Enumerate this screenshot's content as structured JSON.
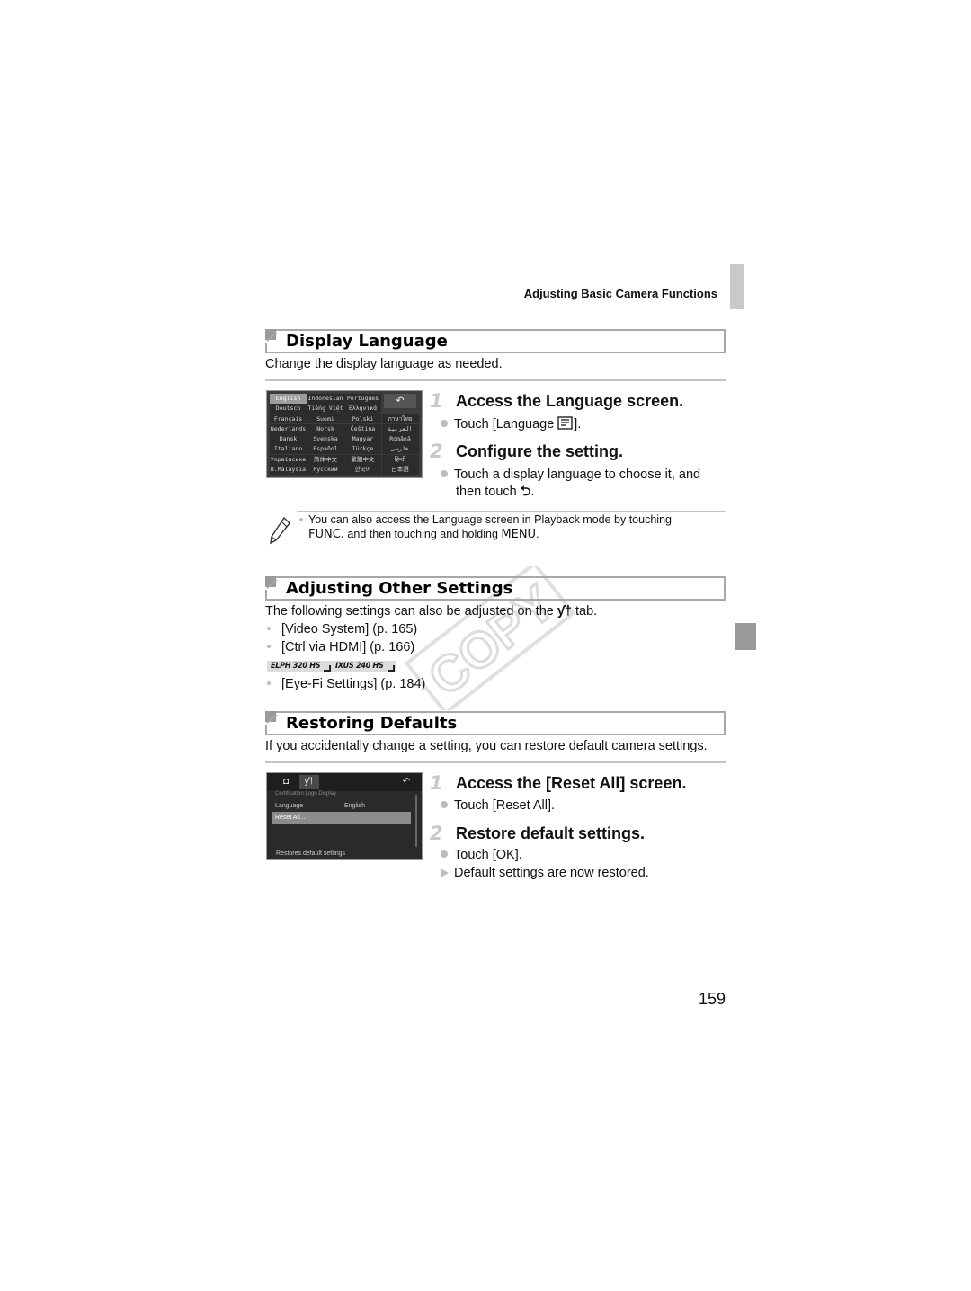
{
  "running_head": "Adjusting Basic Camera Functions",
  "page_number": "159",
  "watermark": "COPY",
  "sections": {
    "display_language": {
      "title": "Display Language",
      "intro": "Change the display language as needed.",
      "screen": {
        "back_label": "↶",
        "languages": [
          [
            "English",
            "Indonesian",
            "Português",
            ""
          ],
          [
            "Deutsch",
            "Tiếng Việt",
            "Ελληνικά",
            ""
          ],
          [
            "Français",
            "Suomi",
            "Polski",
            "ภาษาไทย"
          ],
          [
            "Nederlands",
            "Norsk",
            "Čeština",
            "العربية"
          ],
          [
            "Dansk",
            "Svenska",
            "Magyar",
            "Română"
          ],
          [
            "Italiano",
            "Español",
            "Türkçe",
            "فارسی"
          ],
          [
            "Українська",
            "简体中文",
            "繁體中文",
            "हिन्दी"
          ],
          [
            "B.Malaysia",
            "Русский",
            "한국어",
            "日本語"
          ]
        ],
        "selected": "English"
      },
      "steps": [
        {
          "num": "1",
          "title": "Access the Language screen.",
          "bullets": [
            {
              "type": "dot",
              "text": "Touch [Language ",
              "suffix": "]."
            }
          ]
        },
        {
          "num": "2",
          "title": "Configure the setting.",
          "bullets": [
            {
              "type": "dot",
              "text": "Touch a display language to choose it, and",
              "line2": "then touch ",
              "suffix": "."
            }
          ]
        }
      ],
      "note": {
        "line1": "You can also access the Language screen in Playback mode by touching",
        "kw1": "FUNC.",
        "mid": " and then touching and holding ",
        "kw2": "MENU",
        "end": "."
      }
    },
    "other_settings": {
      "title": "Adjusting Other Settings",
      "intro_pre": "The following settings can also be adjusted on the ",
      "intro_post": " tab.",
      "items": [
        "[Video System] (p. 165)",
        "[Ctrl via HDMI] (p. 166)"
      ],
      "model_tags": [
        "ELPH 320 HS",
        "IXUS 240 HS"
      ],
      "model_items": [
        "[Eye-Fi Settings] (p. 184)"
      ]
    },
    "restoring_defaults": {
      "title": "Restoring Defaults",
      "intro": "If you accidentally change a setting, you can restore default camera settings.",
      "screen": {
        "top_row": "Certification Logo Display",
        "rows": [
          {
            "label": "Language",
            "value": "English"
          },
          {
            "label": "Reset All...",
            "value": ""
          }
        ],
        "footer": "Restores default settings"
      },
      "steps": [
        {
          "num": "1",
          "title": "Access the [Reset All] screen.",
          "bullets": [
            {
              "type": "dot",
              "text": "Touch [Reset All]."
            }
          ]
        },
        {
          "num": "2",
          "title": "Restore default settings.",
          "bullets": [
            {
              "type": "dot",
              "text": "Touch [OK]."
            },
            {
              "type": "arrow",
              "text": "Default settings are now restored."
            }
          ]
        }
      ]
    }
  }
}
